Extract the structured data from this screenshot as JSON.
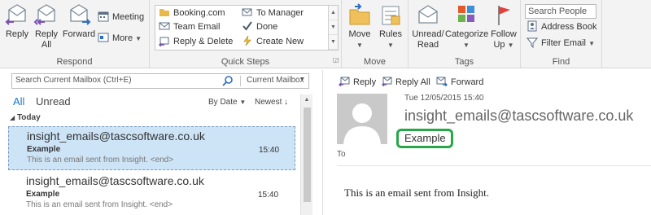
{
  "ribbon": {
    "respond": {
      "label": "Respond",
      "reply": "Reply",
      "reply_all_line1": "Reply",
      "reply_all_line2": "All",
      "forward": "Forward",
      "meeting": "Meeting",
      "more": "More"
    },
    "quick_steps": {
      "label": "Quick Steps",
      "items": [
        "Booking.com",
        "To Manager",
        "Team Email",
        "Done",
        "Reply & Delete",
        "Create New"
      ]
    },
    "move": {
      "label": "Move",
      "move": "Move",
      "rules": "Rules"
    },
    "tags": {
      "label": "Tags",
      "unread_read_line1": "Unread/",
      "unread_read_line2": "Read",
      "categorize": "Categorize",
      "follow_up_line1": "Follow",
      "follow_up_line2": "Up"
    },
    "find": {
      "label": "Find",
      "search_people_placeholder": "Search People",
      "address_book": "Address Book",
      "filter_email": "Filter Email"
    }
  },
  "list_pane": {
    "search_placeholder": "Search Current Mailbox (Ctrl+E)",
    "search_scope": "Current Mailbox",
    "filter_all": "All",
    "filter_unread": "Unread",
    "sort_by": "By Date",
    "sort_order": "Newest",
    "group_header": "Today",
    "messages": [
      {
        "from": "insight_emails@tascsoftware.co.uk",
        "subject": "Example",
        "preview": "This is an email sent from Insight. <end>",
        "time": "15:40"
      },
      {
        "from": "insight_emails@tascsoftware.co.uk",
        "subject": "Example",
        "preview": "This is an email sent from Insight. <end>",
        "time": "15:40"
      }
    ]
  },
  "reading_pane": {
    "actions": {
      "reply": "Reply",
      "reply_all": "Reply All",
      "forward": "Forward"
    },
    "date": "Tue 12/05/2015 15:40",
    "from": "insight_emails@tascsoftware.co.uk",
    "subject": "Example",
    "to_label": "To",
    "body": "This is an email sent from Insight."
  },
  "colors": {
    "accent_blue": "#1e73c9",
    "selected_row": "#cde3f6",
    "highlight_green": "#27a74a",
    "ribbon_bg": "#f3f3f3"
  }
}
